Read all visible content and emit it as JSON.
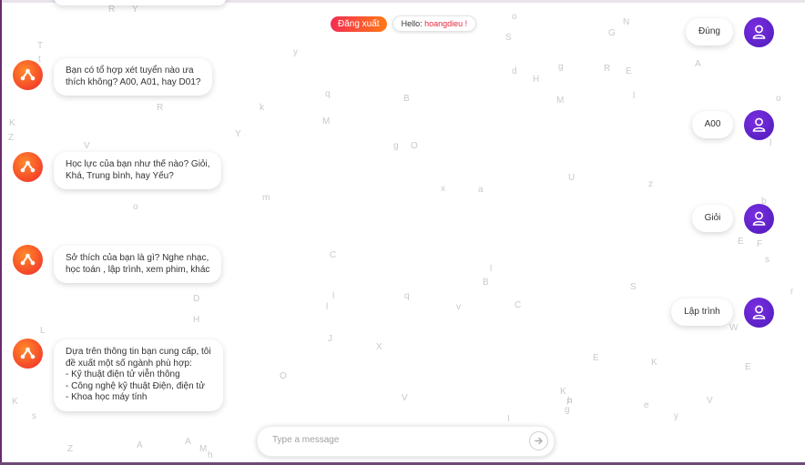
{
  "header": {
    "logout_label": "Đăng xuất",
    "hello_prefix": "Hello:",
    "username": "hoangdieu !"
  },
  "messages": {
    "bot": [
      {
        "text": "Bạn có tổ hợp xét tuyển nào ưa\nthích không? A00, A01, hay D01?"
      },
      {
        "text": "Học lực của bạn như thế nào? Giỏi,\nKhá, Trung bình, hay Yếu?"
      },
      {
        "text": "Sở thích của bạn là gì? Nghe nhạc,\nhọc toán , lập trình, xem phim, khác"
      },
      {
        "text": "Dựa trên thông tin bạn cung cấp, tôi\nđề xuất một số ngành phù hợp:\n- Kỹ thuật điện tử viễn thông\n- Công nghệ kỹ thuật Điện, điện tử\n- Khoa học máy tính"
      }
    ],
    "user": [
      {
        "text": "Đúng"
      },
      {
        "text": "A00"
      },
      {
        "text": "Giỏi"
      },
      {
        "text": "Lập trình"
      }
    ]
  },
  "input": {
    "placeholder": "Type a message",
    "value": ""
  },
  "icons": {
    "bot_avatar": "bot-logo-icon",
    "user_avatar": "user-icon",
    "send": "send-arrow-icon"
  },
  "colors": {
    "logout_gradient_start": "#f32d52",
    "logout_gradient_end": "#ff7a18",
    "bot_avatar": "#f5452a",
    "user_avatar": "#5a21c6",
    "username": "#e6283e"
  },
  "background_letters": [
    "R",
    "Y",
    "T",
    "y",
    "q",
    "B",
    "k",
    "R",
    "M",
    "K",
    "Z",
    "V",
    "Y",
    "g",
    "O",
    "x",
    "o",
    "m",
    "C",
    "D",
    "H",
    "J",
    "X",
    "O",
    "V",
    "K",
    "E",
    "K",
    "s",
    "Z",
    "A",
    "M",
    "A",
    "h",
    "L",
    "t",
    "l",
    "a",
    "C",
    "v",
    "B",
    "I",
    "P",
    "l",
    "V",
    "E",
    "e",
    "y",
    "K",
    "h",
    "q",
    "U",
    "z",
    "b",
    "E",
    "F",
    "s",
    "r",
    "l",
    "W",
    "o",
    "S",
    "N",
    "G",
    "d",
    "H",
    "g",
    "R",
    "E",
    "A",
    "M",
    "l",
    "o",
    "S",
    "g",
    "l"
  ]
}
